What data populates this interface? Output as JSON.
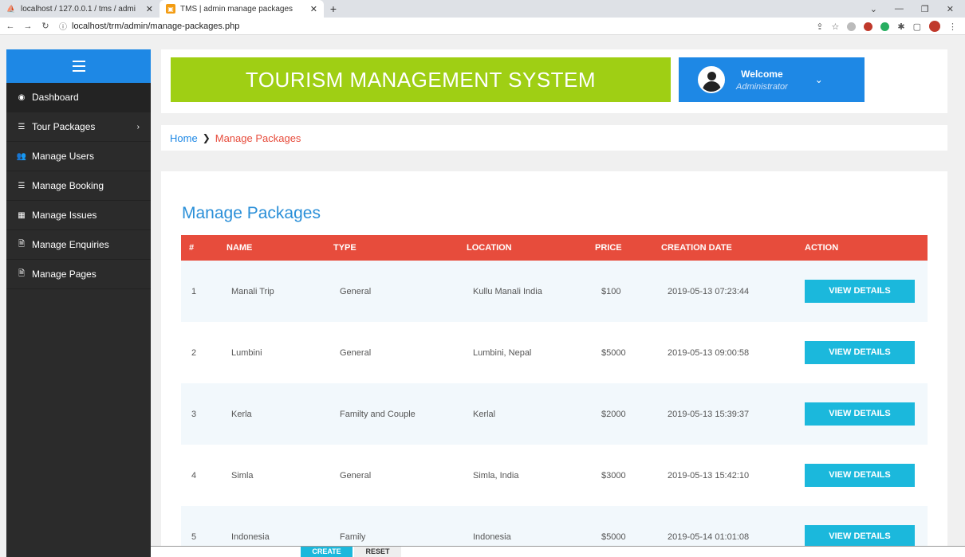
{
  "browser": {
    "tabs": [
      {
        "label": "localhost / 127.0.0.1 / tms / admi",
        "active": false
      },
      {
        "label": "TMS | admin manage packages",
        "active": true
      }
    ],
    "new_tab": "+",
    "url": "localhost/trm/admin/manage-packages.php"
  },
  "sidebar": {
    "items": [
      {
        "label": "Dashboard",
        "icon": "dashboard-icon"
      },
      {
        "label": "Tour Packages",
        "icon": "list-icon",
        "has_submenu": true
      },
      {
        "label": "Manage Users",
        "icon": "users-icon"
      },
      {
        "label": "Manage Booking",
        "icon": "list-icon"
      },
      {
        "label": "Manage Issues",
        "icon": "table-icon"
      },
      {
        "label": "Manage Enquiries",
        "icon": "file-icon"
      },
      {
        "label": "Manage Pages",
        "icon": "file-icon"
      }
    ]
  },
  "header": {
    "title": "TOURISM MANAGEMENT SYSTEM",
    "welcome": "Welcome",
    "role": "Administrator"
  },
  "breadcrumb": {
    "home": "Home",
    "separator": "❯",
    "current": "Manage Packages"
  },
  "main": {
    "title": "Manage Packages",
    "columns": [
      "#",
      "NAME",
      "TYPE",
      "LOCATION",
      "PRICE",
      "CREATION DATE",
      "ACTION"
    ],
    "rows": [
      {
        "id": "1",
        "name": "Manali Trip",
        "type": "General",
        "location": "Kullu Manali India",
        "price": "$100",
        "date": "2019-05-13 07:23:44",
        "action": "VIEW DETAILS"
      },
      {
        "id": "2",
        "name": "Lumbini",
        "type": "General",
        "location": "Lumbini, Nepal",
        "price": "$5000",
        "date": "2019-05-13 09:00:58",
        "action": "VIEW DETAILS"
      },
      {
        "id": "3",
        "name": "Kerla",
        "type": "Familty and Couple",
        "location": "Kerlal",
        "price": "$2000",
        "date": "2019-05-13 15:39:37",
        "action": "VIEW DETAILS"
      },
      {
        "id": "4",
        "name": "Simla",
        "type": "General",
        "location": "Simla, India",
        "price": "$3000",
        "date": "2019-05-13 15:42:10",
        "action": "VIEW DETAILS"
      },
      {
        "id": "5",
        "name": "Indonesia",
        "type": "Family",
        "location": "Indonesia",
        "price": "$5000",
        "date": "2019-05-14 01:01:08",
        "action": "VIEW DETAILS"
      }
    ]
  },
  "footer": {
    "create_label": "CREATE",
    "reset_label": "RESET"
  },
  "colors": {
    "banner": "#9fcf14",
    "user_panel": "#1e88e5",
    "table_header": "#e74c3c",
    "action_button": "#1bb8dc",
    "page_title": "#2a8fd8"
  }
}
